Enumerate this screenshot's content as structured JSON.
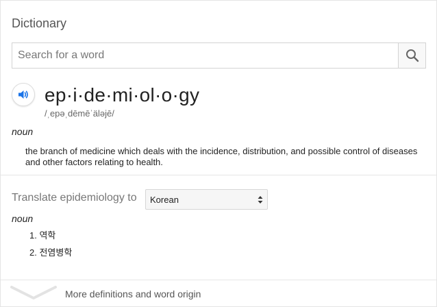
{
  "card": {
    "title": "Dictionary"
  },
  "search": {
    "placeholder": "Search for a word",
    "value": "",
    "icon": "search-icon"
  },
  "entry": {
    "audio_icon": "speaker-icon",
    "headword": "ep·i·de·mi·ol·o·gy",
    "phonetic": "/ˌepəˌdēmēˈäləjē/",
    "part_of_speech": "noun",
    "definition": "the branch of medicine which deals with the incidence, distribution, and possible control of diseases and other factors relating to health."
  },
  "translate": {
    "label": "Translate epidemiology to",
    "selected_language": "Korean",
    "part_of_speech": "noun",
    "items": [
      {
        "number": "1.",
        "text": "역학"
      },
      {
        "number": "2.",
        "text": "전염병학"
      }
    ]
  },
  "footer": {
    "more_label": "More definitions and word origin",
    "icon": "chevron-down-icon"
  },
  "colors": {
    "accent_blue": "#1a73e8",
    "border": "#d3d3d3",
    "muted_text": "#777777"
  }
}
